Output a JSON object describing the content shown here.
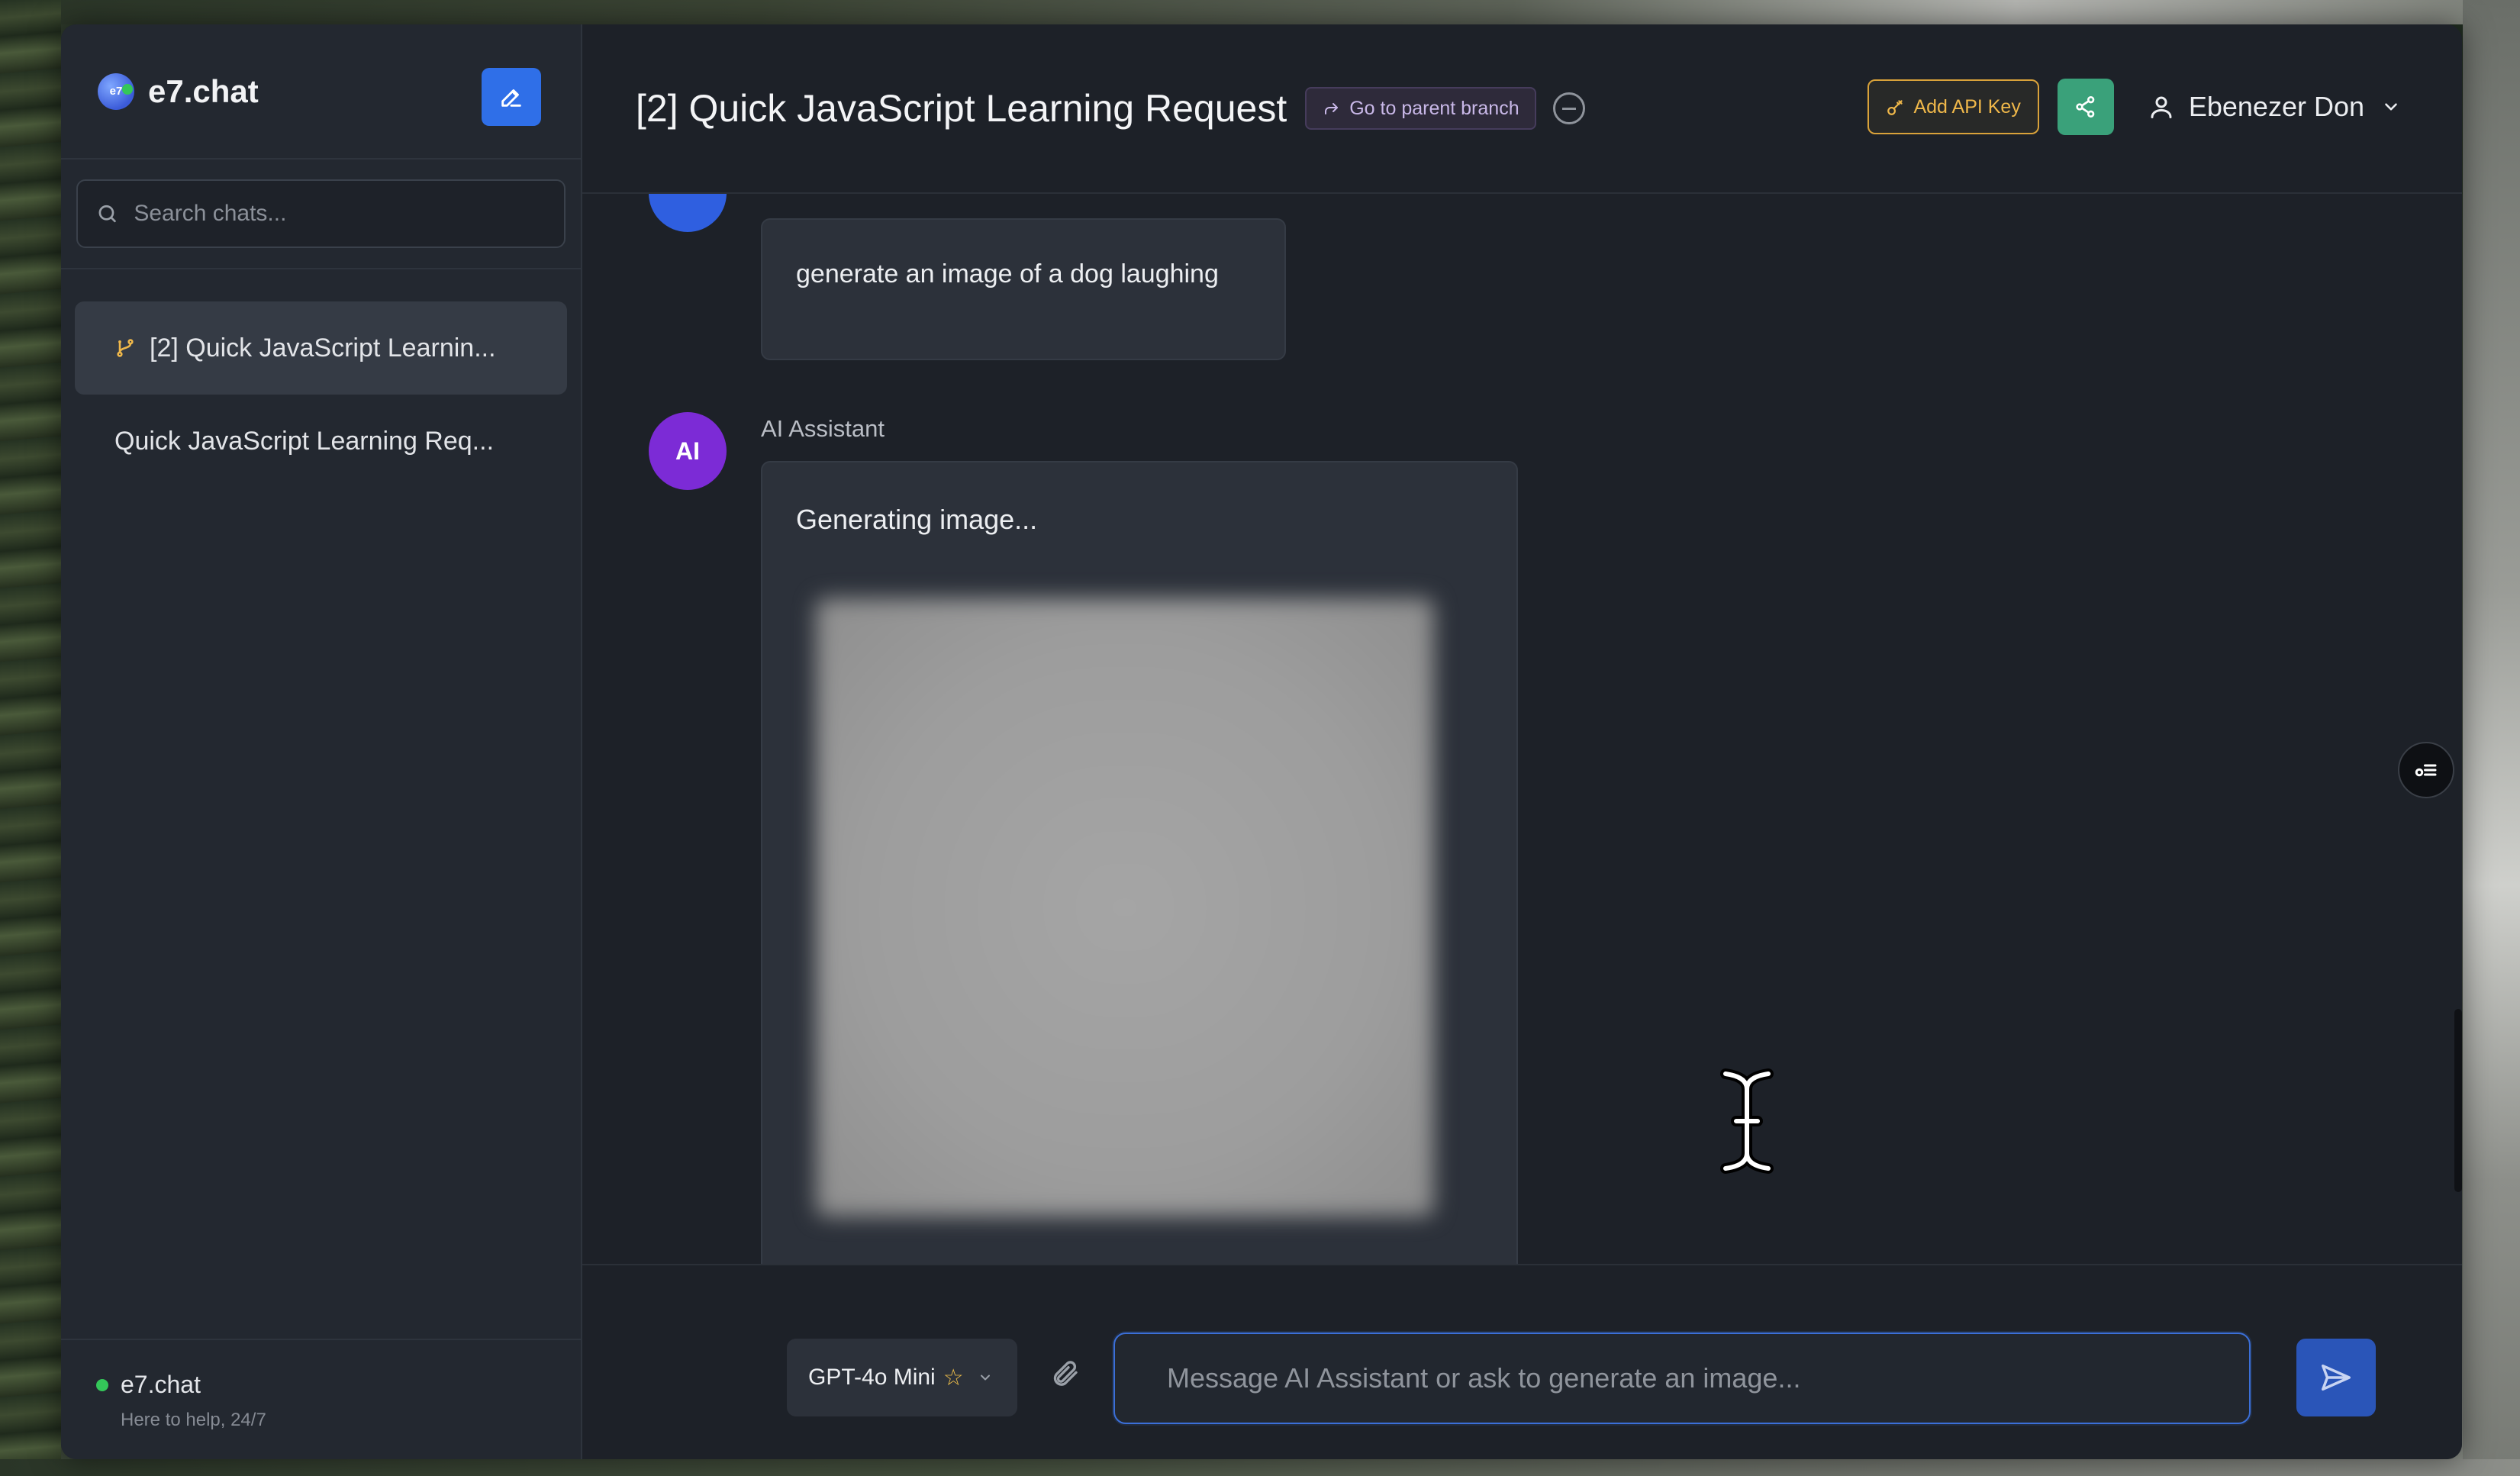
{
  "app": {
    "brand": "e7.chat",
    "brand_logo_text": "e7"
  },
  "search": {
    "placeholder": "Search chats..."
  },
  "chats": [
    {
      "label": "[2] Quick JavaScript Learnin...",
      "active": true,
      "branch": true
    },
    {
      "label": "Quick JavaScript Learning Req...",
      "active": false,
      "branch": false
    }
  ],
  "footer": {
    "title": "e7.chat",
    "subtitle": "Here to help, 24/7"
  },
  "header": {
    "title": "[2] Quick JavaScript Learning Request",
    "parent_branch_label": "Go to parent branch",
    "api_key_label": "Add API Key",
    "user_name": "Ebenezer Don"
  },
  "messages": {
    "user_message": "generate an image of a dog laughing",
    "ai_name": "AI Assistant",
    "ai_avatar": "AI",
    "ai_message": "Generating image..."
  },
  "composer": {
    "model": "GPT-4o Mini",
    "model_star": "☆",
    "placeholder": "Message AI Assistant or ask to generate an image..."
  },
  "colors": {
    "accent": "#2f6fe8",
    "ai_avatar": "#7c2bd6",
    "share": "#3aa17a",
    "api_key": "#d9a23a",
    "online": "#34c759"
  }
}
